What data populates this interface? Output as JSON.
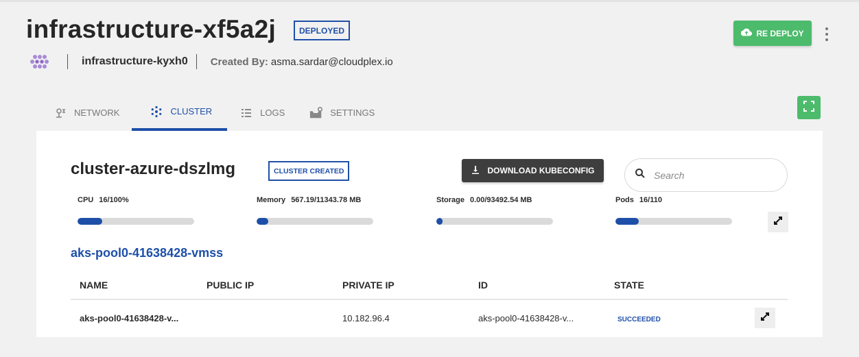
{
  "header": {
    "title": "infrastructure-xf5a2j",
    "status_badge": "DEPLOYED",
    "redeploy_label": "RE DEPLOY",
    "infrastructure_name": "infrastructure-kyxh0",
    "created_by_label": "Created By:",
    "created_by_value": "asma.sardar@cloudplex.io"
  },
  "tabs": [
    {
      "label": "NETWORK",
      "icon": "network-icon",
      "active": false
    },
    {
      "label": "CLUSTER",
      "icon": "cluster-icon",
      "active": true
    },
    {
      "label": "LOGS",
      "icon": "logs-icon",
      "active": false
    },
    {
      "label": "SETTINGS",
      "icon": "settings-icon",
      "active": false
    }
  ],
  "cluster": {
    "name": "cluster-azure-dszlmg",
    "status_badge": "CLUSTER CREATED",
    "download_label": "DOWNLOAD KUBECONFIG",
    "search_placeholder": "Search",
    "metrics": [
      {
        "label": "CPU",
        "value": "16/100%",
        "fraction": 0.21
      },
      {
        "label": "Memory",
        "value": "567.19/11343.78 MB",
        "fraction": 0.1
      },
      {
        "label": "Storage",
        "value": "0.00/93492.54 MB",
        "fraction": 0.05
      },
      {
        "label": "Pods",
        "value": "16/110",
        "fraction": 0.2
      }
    ]
  },
  "pool": {
    "name": "aks-pool0-41638428-vmss",
    "columns": [
      "NAME",
      "PUBLIC IP",
      "PRIVATE IP",
      "ID",
      "STATE"
    ],
    "rows": [
      {
        "name": "aks-pool0-41638428-v...",
        "public_ip": "",
        "private_ip": "10.182.96.4",
        "id": "aks-pool0-41638428-v...",
        "state": "SUCCEEDED"
      }
    ]
  },
  "colors": {
    "accent": "#1e4fa8",
    "success": "#4cbb6c",
    "dark_button": "#3e3e3e",
    "background": "#f1f1f1"
  }
}
